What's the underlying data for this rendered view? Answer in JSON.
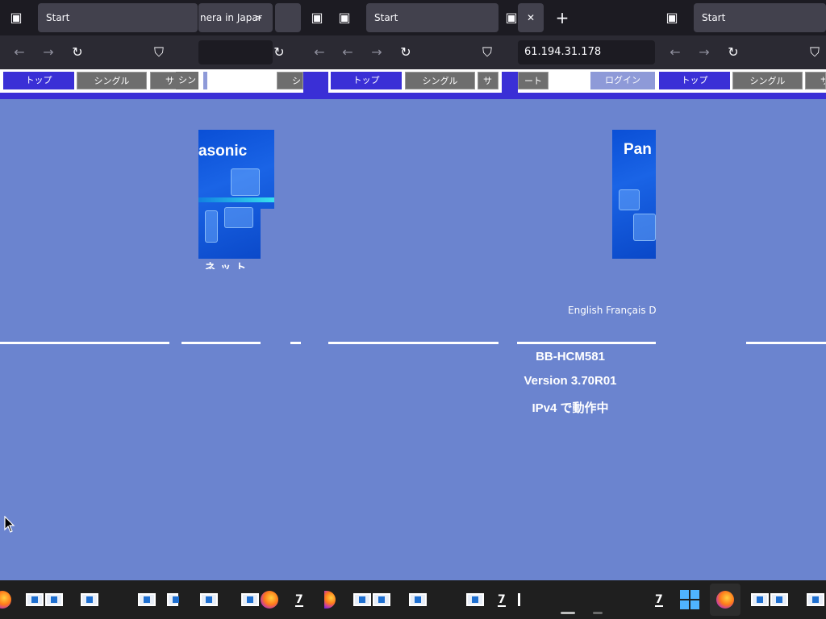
{
  "browser": {
    "tabs": [
      {
        "title": "Start"
      },
      {
        "title": "nera in Japar"
      },
      {
        "title": "Start"
      },
      {
        "title": "Start"
      }
    ],
    "new_tab_symbol": "+",
    "close_tab_symbol": "✕",
    "address": "61.194.31.178",
    "chevron": ">"
  },
  "menu": {
    "top": "トップ",
    "single": "シングル",
    "single_partial": "シン",
    "setup_partial": "サ",
    "setup_tail": "ート",
    "sh_partial": "シ",
    "login": "ログイン"
  },
  "logo": {
    "brand_partial_left": "asonic",
    "brand_partial_right": "Pan"
  },
  "page": {
    "network_partial": "ネット",
    "languages": "English Français D",
    "model": "BB-HCM581",
    "version": "Version 3.70R01",
    "ipv4_status": "IPv4 で動作中"
  },
  "icons": {
    "back": "arrow-left-icon",
    "forward": "arrow-right-icon",
    "reload": "reload-icon",
    "shield": "shield-icon",
    "tab_list": "tab-list-icon",
    "firefox": "firefox-icon",
    "windows": "windows-start-icon"
  },
  "colors": {
    "page_bg": "#6b84cf",
    "menu_band": "#3a2fd6",
    "browser_bg": "#1c1b22",
    "taskbar": "#1f1f1f"
  }
}
